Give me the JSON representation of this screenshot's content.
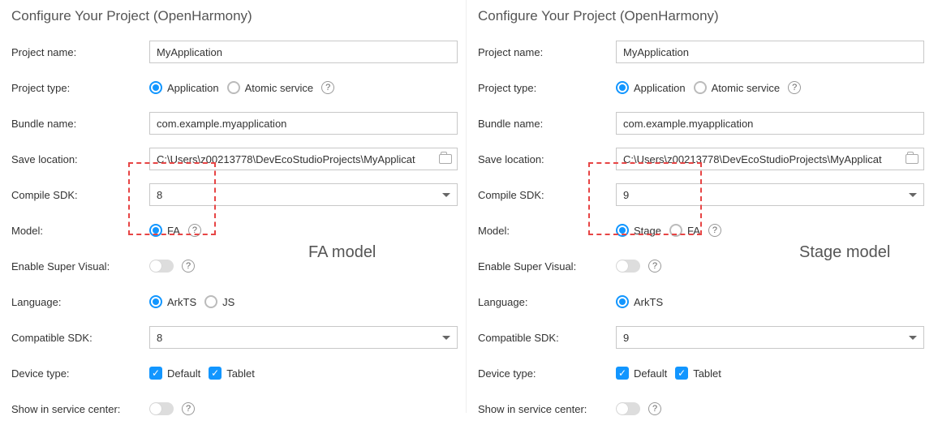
{
  "left": {
    "title": "Configure Your Project (OpenHarmony)",
    "labels": {
      "project_name": "Project name:",
      "project_type": "Project type:",
      "bundle_name": "Bundle name:",
      "save_location": "Save location:",
      "compile_sdk": "Compile SDK:",
      "model": "Model:",
      "enable_super_visual": "Enable Super Visual:",
      "language": "Language:",
      "compatible_sdk": "Compatible SDK:",
      "device_type": "Device type:",
      "show_in_service_center": "Show in service center:"
    },
    "values": {
      "project_name": "MyApplication",
      "bundle_name": "com.example.myapplication",
      "save_location": "C:\\Users\\z00213778\\DevEcoStudioProjects\\MyApplicat",
      "compile_sdk": "8",
      "compatible_sdk": "8"
    },
    "project_type": {
      "application": "Application",
      "atomic": "Atomic service",
      "selected": "Application"
    },
    "model": {
      "fa": "FA",
      "selected": "FA"
    },
    "language": {
      "arkts": "ArkTS",
      "js": "JS",
      "selected": "ArkTS"
    },
    "device_type": {
      "default": "Default",
      "tablet": "Tablet"
    },
    "annotation": "FA model"
  },
  "right": {
    "title": "Configure Your Project (OpenHarmony)",
    "labels": {
      "project_name": "Project name:",
      "project_type": "Project type:",
      "bundle_name": "Bundle name:",
      "save_location": "Save location:",
      "compile_sdk": "Compile SDK:",
      "model": "Model:",
      "enable_super_visual": "Enable Super Visual:",
      "language": "Language:",
      "compatible_sdk": "Compatible SDK:",
      "device_type": "Device type:",
      "show_in_service_center": "Show in service center:"
    },
    "values": {
      "project_name": "MyApplication",
      "bundle_name": "com.example.myapplication",
      "save_location": "C:\\Users\\z00213778\\DevEcoStudioProjects\\MyApplicat",
      "compile_sdk": "9",
      "compatible_sdk": "9"
    },
    "project_type": {
      "application": "Application",
      "atomic": "Atomic service",
      "selected": "Application"
    },
    "model": {
      "stage": "Stage",
      "fa": "FA",
      "selected": "Stage"
    },
    "language": {
      "arkts": "ArkTS",
      "selected": "ArkTS"
    },
    "device_type": {
      "default": "Default",
      "tablet": "Tablet"
    },
    "annotation": "Stage model"
  }
}
